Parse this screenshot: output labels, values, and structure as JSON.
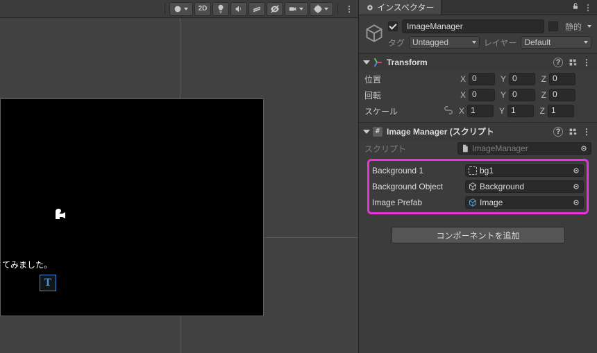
{
  "scene": {
    "button_2d": "2D",
    "panel_text": "てみました。",
    "text_gizmo": "T"
  },
  "inspector": {
    "tab_label": "インスペクター",
    "static_label": "静的",
    "tag_label": "タグ",
    "layer_label": "レイヤー",
    "add_component": "コンポーネントを追加"
  },
  "game_object": {
    "name": "ImageManager",
    "active": true,
    "tag": "Untagged",
    "layer": "Default"
  },
  "transform": {
    "title": "Transform",
    "position_label": "位置",
    "rotation_label": "回転",
    "scale_label": "スケール",
    "position": {
      "x": "0",
      "y": "0",
      "z": "0"
    },
    "rotation": {
      "x": "0",
      "y": "0",
      "z": "0"
    },
    "scale": {
      "x": "1",
      "y": "1",
      "z": "1"
    }
  },
  "image_manager": {
    "title": "Image Manager (スクリプト",
    "script_label": "スクリプト",
    "script_value": "ImageManager",
    "fields": {
      "bg1": {
        "label": "Background 1",
        "value": "bg1"
      },
      "bg_obj": {
        "label": "Background Object",
        "value": "Background"
      },
      "img_prefab": {
        "label": "Image Prefab",
        "value": "Image"
      }
    }
  }
}
